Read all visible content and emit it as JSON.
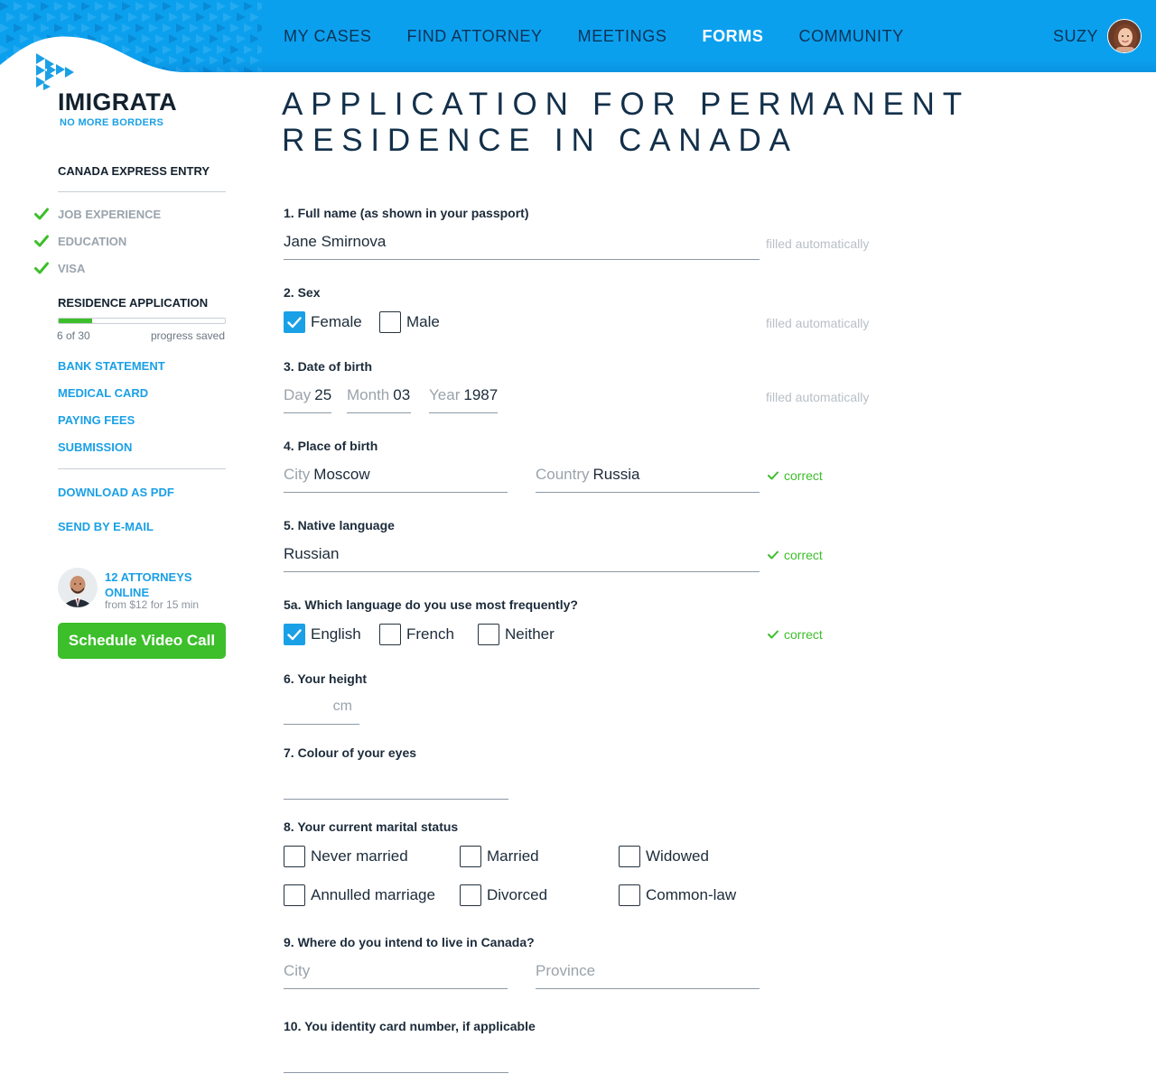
{
  "colors": {
    "accent": "#0ba0ee",
    "link": "#1aa0e6",
    "success": "#3cbf2a",
    "text": "#1c2b3a"
  },
  "nav": {
    "items": [
      "MY CASES",
      "FIND ATTORNEY",
      "MEETINGS",
      "FORMS",
      "COMMUNITY"
    ],
    "active": "FORMS",
    "user_name": "SUZY"
  },
  "logo": {
    "name": "IMIGRATA",
    "tagline": "NO MORE BORDERS"
  },
  "sidebar": {
    "section1": "CANADA EXPRESS ENTRY",
    "completed": [
      "JOB EXPERIENCE",
      "EDUCATION",
      "VISA"
    ],
    "current": "RESIDENCE APPLICATION",
    "progress": {
      "done": 6,
      "total": 30,
      "count_text": "6 of 30",
      "saved_text": "progress saved"
    },
    "upcoming": [
      "BANK STATEMENT",
      "MEDICAL CARD",
      "PAYING FEES",
      "SUBMISSION"
    ],
    "actions": [
      "DOWNLOAD AS PDF",
      "SEND BY E-MAIL"
    ],
    "attorneys": {
      "title": "12 ATTORNEYS ONLINE",
      "price": "from $12 for 15 min",
      "button": "Schedule Video Call"
    }
  },
  "form": {
    "title_line1": "APPLICATION FOR PERMANENT",
    "title_line2": "RESIDENCE IN CANADA",
    "q1": {
      "label": "1. Full name (as shown in your passport)",
      "value": "Jane Smirnova",
      "note": "filled automatically"
    },
    "q2": {
      "label": "2. Sex",
      "options": [
        "Female",
        "Male"
      ],
      "checked": [
        true,
        false
      ],
      "note": "filled automatically"
    },
    "q3": {
      "label": "3. Date of birth",
      "day_label": "Day",
      "day": "25",
      "month_label": "Month",
      "month": "03",
      "year_label": "Year",
      "year": "1987",
      "note": "filled automatically"
    },
    "q4": {
      "label": "4. Place of birth",
      "city_label": "City",
      "city": "Moscow",
      "country_label": "Country",
      "country": "Russia",
      "status": "correct"
    },
    "q5": {
      "label": "5. Native language",
      "value": "Russian",
      "status": "correct"
    },
    "q5a": {
      "label": "5a. Which language do you use most frequently?",
      "options": [
        "English",
        "French",
        "Neither"
      ],
      "checked": [
        true,
        false,
        false
      ],
      "status": "correct"
    },
    "q6": {
      "label": "6. Your height",
      "value": "",
      "unit": "cm"
    },
    "q7": {
      "label": "7. Colour of your eyes",
      "value": ""
    },
    "q8": {
      "label": "8. Your current marital status",
      "options": [
        "Never married",
        "Married",
        "Widowed",
        "Annulled marriage",
        "Divorced",
        "Common-law"
      ],
      "checked": [
        false,
        false,
        false,
        false,
        false,
        false
      ]
    },
    "q9": {
      "label": "9. Where do you intend to live in Canada?",
      "city_placeholder": "City",
      "province_placeholder": "Province"
    },
    "q10": {
      "label": "10. You identity card number, if applicable",
      "value": ""
    }
  }
}
